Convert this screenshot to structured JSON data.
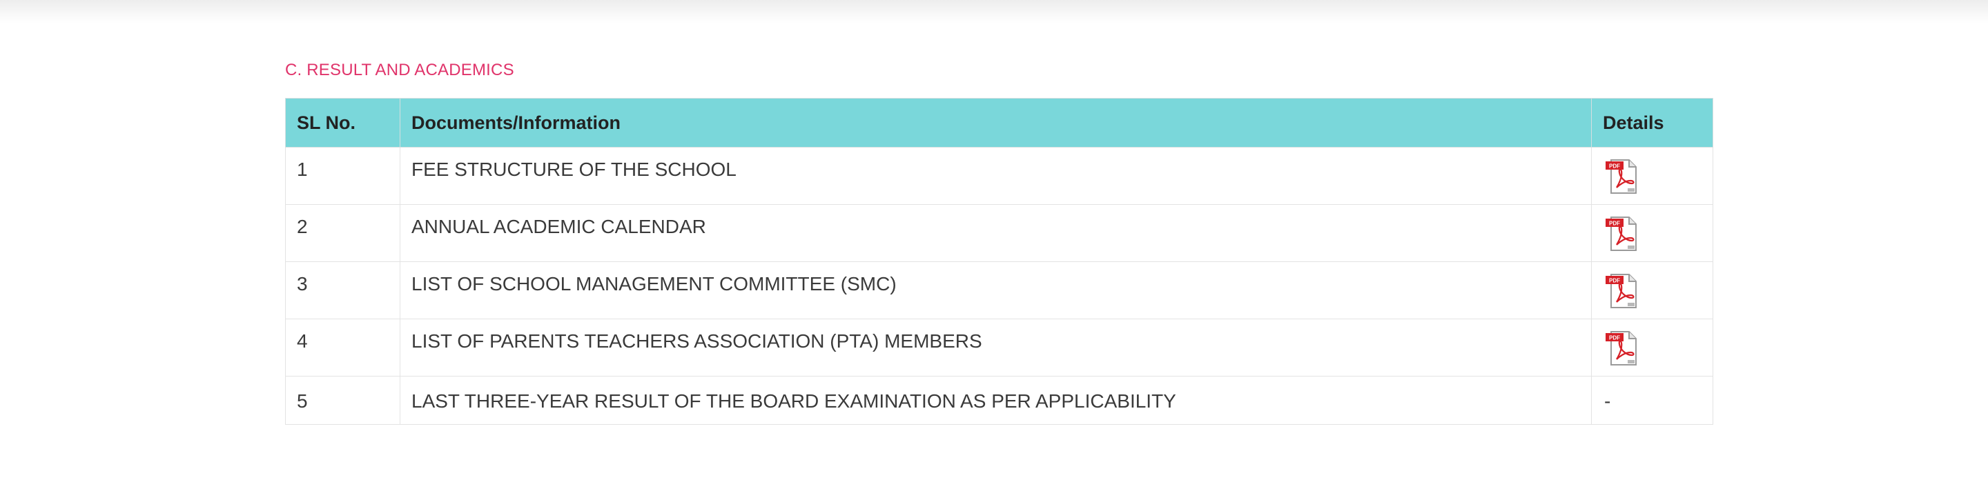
{
  "section": {
    "title": "C. RESULT AND ACADEMICS"
  },
  "table": {
    "headers": {
      "sl_no": "SL No.",
      "documents": "Documents/Information",
      "details": "Details"
    },
    "rows": [
      {
        "sl": "1",
        "doc": "FEE STRUCTURE OF THE SCHOOL",
        "details": "pdf-icon"
      },
      {
        "sl": "2",
        "doc": "ANNUAL ACADEMIC CALENDAR",
        "details": "pdf-icon"
      },
      {
        "sl": "3",
        "doc": "LIST OF SCHOOL MANAGEMENT COMMITTEE (SMC)",
        "details": "pdf-icon"
      },
      {
        "sl": "4",
        "doc": "LIST OF PARENTS TEACHERS ASSOCIATION (PTA) MEMBERS",
        "details": "pdf-icon"
      },
      {
        "sl": "5",
        "doc": "LAST THREE-YEAR RESULT OF THE BOARD EXAMINATION AS PER APPLICABILITY",
        "details": "-"
      }
    ]
  },
  "colors": {
    "title": "#e0336a",
    "header_bg": "#7ad7da",
    "pdf_red": "#d62027"
  }
}
